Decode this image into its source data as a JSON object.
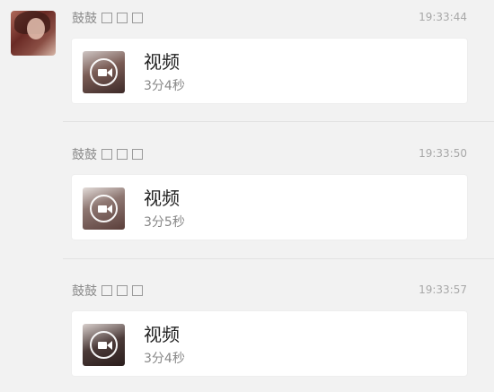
{
  "messages": [
    {
      "sender": "鼓鼓",
      "time": "19:33:44",
      "card": {
        "title": "视频",
        "duration": "3分4秒"
      }
    },
    {
      "sender": "鼓鼓",
      "time": "19:33:50",
      "card": {
        "title": "视频",
        "duration": "3分5秒"
      }
    },
    {
      "sender": "鼓鼓",
      "time": "19:33:57",
      "card": {
        "title": "视频",
        "duration": "3分4秒"
      }
    }
  ],
  "icons": {
    "avatar": "user-avatar",
    "placeholder": "box-glyph-icon",
    "video": "video-camera-icon"
  },
  "colors": {
    "background": "#f2f2f2",
    "card": "#ffffff",
    "sender_text": "#8a8a8a",
    "time_text": "#a8a8a8",
    "title_text": "#222222",
    "duration_text": "#888888"
  }
}
